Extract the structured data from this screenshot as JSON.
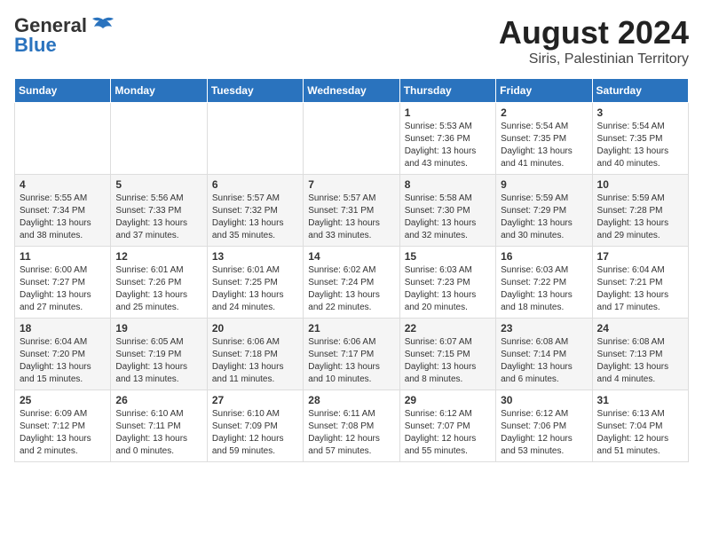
{
  "header": {
    "logo_general": "General",
    "logo_blue": "Blue",
    "title": "August 2024",
    "subtitle": "Siris, Palestinian Territory"
  },
  "days_of_week": [
    "Sunday",
    "Monday",
    "Tuesday",
    "Wednesday",
    "Thursday",
    "Friday",
    "Saturday"
  ],
  "weeks": [
    [
      {
        "day": "",
        "info": ""
      },
      {
        "day": "",
        "info": ""
      },
      {
        "day": "",
        "info": ""
      },
      {
        "day": "",
        "info": ""
      },
      {
        "day": "1",
        "info": "Sunrise: 5:53 AM\nSunset: 7:36 PM\nDaylight: 13 hours\nand 43 minutes."
      },
      {
        "day": "2",
        "info": "Sunrise: 5:54 AM\nSunset: 7:35 PM\nDaylight: 13 hours\nand 41 minutes."
      },
      {
        "day": "3",
        "info": "Sunrise: 5:54 AM\nSunset: 7:35 PM\nDaylight: 13 hours\nand 40 minutes."
      }
    ],
    [
      {
        "day": "4",
        "info": "Sunrise: 5:55 AM\nSunset: 7:34 PM\nDaylight: 13 hours\nand 38 minutes."
      },
      {
        "day": "5",
        "info": "Sunrise: 5:56 AM\nSunset: 7:33 PM\nDaylight: 13 hours\nand 37 minutes."
      },
      {
        "day": "6",
        "info": "Sunrise: 5:57 AM\nSunset: 7:32 PM\nDaylight: 13 hours\nand 35 minutes."
      },
      {
        "day": "7",
        "info": "Sunrise: 5:57 AM\nSunset: 7:31 PM\nDaylight: 13 hours\nand 33 minutes."
      },
      {
        "day": "8",
        "info": "Sunrise: 5:58 AM\nSunset: 7:30 PM\nDaylight: 13 hours\nand 32 minutes."
      },
      {
        "day": "9",
        "info": "Sunrise: 5:59 AM\nSunset: 7:29 PM\nDaylight: 13 hours\nand 30 minutes."
      },
      {
        "day": "10",
        "info": "Sunrise: 5:59 AM\nSunset: 7:28 PM\nDaylight: 13 hours\nand 29 minutes."
      }
    ],
    [
      {
        "day": "11",
        "info": "Sunrise: 6:00 AM\nSunset: 7:27 PM\nDaylight: 13 hours\nand 27 minutes."
      },
      {
        "day": "12",
        "info": "Sunrise: 6:01 AM\nSunset: 7:26 PM\nDaylight: 13 hours\nand 25 minutes."
      },
      {
        "day": "13",
        "info": "Sunrise: 6:01 AM\nSunset: 7:25 PM\nDaylight: 13 hours\nand 24 minutes."
      },
      {
        "day": "14",
        "info": "Sunrise: 6:02 AM\nSunset: 7:24 PM\nDaylight: 13 hours\nand 22 minutes."
      },
      {
        "day": "15",
        "info": "Sunrise: 6:03 AM\nSunset: 7:23 PM\nDaylight: 13 hours\nand 20 minutes."
      },
      {
        "day": "16",
        "info": "Sunrise: 6:03 AM\nSunset: 7:22 PM\nDaylight: 13 hours\nand 18 minutes."
      },
      {
        "day": "17",
        "info": "Sunrise: 6:04 AM\nSunset: 7:21 PM\nDaylight: 13 hours\nand 17 minutes."
      }
    ],
    [
      {
        "day": "18",
        "info": "Sunrise: 6:04 AM\nSunset: 7:20 PM\nDaylight: 13 hours\nand 15 minutes."
      },
      {
        "day": "19",
        "info": "Sunrise: 6:05 AM\nSunset: 7:19 PM\nDaylight: 13 hours\nand 13 minutes."
      },
      {
        "day": "20",
        "info": "Sunrise: 6:06 AM\nSunset: 7:18 PM\nDaylight: 13 hours\nand 11 minutes."
      },
      {
        "day": "21",
        "info": "Sunrise: 6:06 AM\nSunset: 7:17 PM\nDaylight: 13 hours\nand 10 minutes."
      },
      {
        "day": "22",
        "info": "Sunrise: 6:07 AM\nSunset: 7:15 PM\nDaylight: 13 hours\nand 8 minutes."
      },
      {
        "day": "23",
        "info": "Sunrise: 6:08 AM\nSunset: 7:14 PM\nDaylight: 13 hours\nand 6 minutes."
      },
      {
        "day": "24",
        "info": "Sunrise: 6:08 AM\nSunset: 7:13 PM\nDaylight: 13 hours\nand 4 minutes."
      }
    ],
    [
      {
        "day": "25",
        "info": "Sunrise: 6:09 AM\nSunset: 7:12 PM\nDaylight: 13 hours\nand 2 minutes."
      },
      {
        "day": "26",
        "info": "Sunrise: 6:10 AM\nSunset: 7:11 PM\nDaylight: 13 hours\nand 0 minutes."
      },
      {
        "day": "27",
        "info": "Sunrise: 6:10 AM\nSunset: 7:09 PM\nDaylight: 12 hours\nand 59 minutes."
      },
      {
        "day": "28",
        "info": "Sunrise: 6:11 AM\nSunset: 7:08 PM\nDaylight: 12 hours\nand 57 minutes."
      },
      {
        "day": "29",
        "info": "Sunrise: 6:12 AM\nSunset: 7:07 PM\nDaylight: 12 hours\nand 55 minutes."
      },
      {
        "day": "30",
        "info": "Sunrise: 6:12 AM\nSunset: 7:06 PM\nDaylight: 12 hours\nand 53 minutes."
      },
      {
        "day": "31",
        "info": "Sunrise: 6:13 AM\nSunset: 7:04 PM\nDaylight: 12 hours\nand 51 minutes."
      }
    ]
  ]
}
